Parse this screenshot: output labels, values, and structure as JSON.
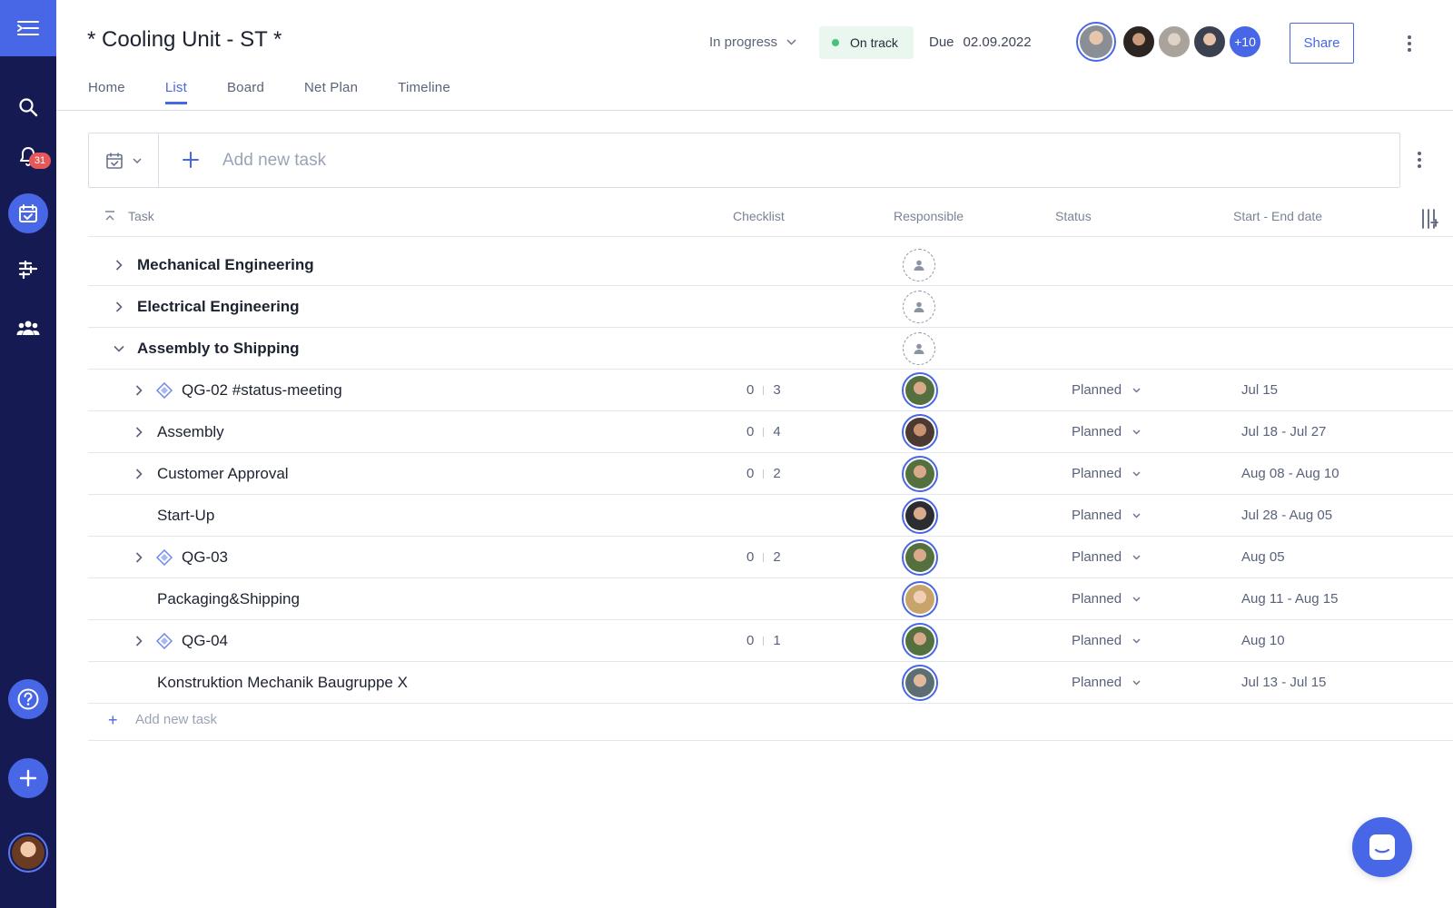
{
  "sidebar": {
    "notification_count": "31",
    "icons": [
      "menu-toggle-icon",
      "search-icon",
      "bell-icon",
      "calendar-check-icon",
      "timeline-icon",
      "team-icon",
      "help-icon",
      "plus-icon"
    ]
  },
  "header": {
    "title": "* Cooling Unit - ST *",
    "progress_status": "In progress",
    "health_status": "On track",
    "due_label": "Due",
    "due_date": "02.09.2022",
    "more_members": "+10",
    "share_label": "Share",
    "tabs": [
      {
        "label": "Home",
        "active": false
      },
      {
        "label": "List",
        "active": true
      },
      {
        "label": "Board",
        "active": false
      },
      {
        "label": "Net Plan",
        "active": false
      },
      {
        "label": "Timeline",
        "active": false
      }
    ]
  },
  "add_task": {
    "placeholder": "Add new task"
  },
  "table": {
    "columns": {
      "task": "Task",
      "checklist": "Checklist",
      "responsible": "Responsible",
      "status": "Status",
      "dates": "Start - End date"
    },
    "groups": [
      {
        "name": "Mechanical Engineering",
        "expanded": false
      },
      {
        "name": "Electrical Engineering",
        "expanded": false
      },
      {
        "name": "Assembly to Shipping",
        "expanded": true
      }
    ],
    "tasks": [
      {
        "name": "QG-02 #status-meeting",
        "milestone": true,
        "expandable": true,
        "checklist_done": "0",
        "checklist_total": "3",
        "status": "Planned",
        "dates": "Jul 15"
      },
      {
        "name": "Assembly",
        "milestone": false,
        "expandable": true,
        "checklist_done": "0",
        "checklist_total": "4",
        "status": "Planned",
        "dates": "Jul 18 - Jul 27"
      },
      {
        "name": "Customer Approval",
        "milestone": false,
        "expandable": true,
        "checklist_done": "0",
        "checklist_total": "2",
        "status": "Planned",
        "dates": "Aug 08 - Aug 10"
      },
      {
        "name": "Start-Up",
        "milestone": false,
        "expandable": false,
        "checklist_done": "",
        "checklist_total": "",
        "status": "Planned",
        "dates": "Jul 28 - Aug 05"
      },
      {
        "name": "QG-03",
        "milestone": true,
        "expandable": true,
        "checklist_done": "0",
        "checklist_total": "2",
        "status": "Planned",
        "dates": "Aug 05"
      },
      {
        "name": "Packaging&Shipping",
        "milestone": false,
        "expandable": false,
        "checklist_done": "",
        "checklist_total": "",
        "status": "Planned",
        "dates": "Aug 11 - Aug 15"
      },
      {
        "name": "QG-04",
        "milestone": true,
        "expandable": true,
        "checklist_done": "0",
        "checklist_total": "1",
        "status": "Planned",
        "dates": "Aug 10"
      },
      {
        "name": "Konstruktion Mechanik Baugruppe X",
        "milestone": false,
        "expandable": false,
        "checklist_done": "",
        "checklist_total": "",
        "status": "Planned",
        "dates": "Jul 13 - Jul 15"
      }
    ],
    "add_new_task_label": "Add new task"
  },
  "colors": {
    "accent": "#4867e6",
    "sidebar": "#161a52",
    "on_track_bg": "#eaf7ef",
    "on_track_dot": "#47c27c",
    "badge": "#e5585a"
  }
}
